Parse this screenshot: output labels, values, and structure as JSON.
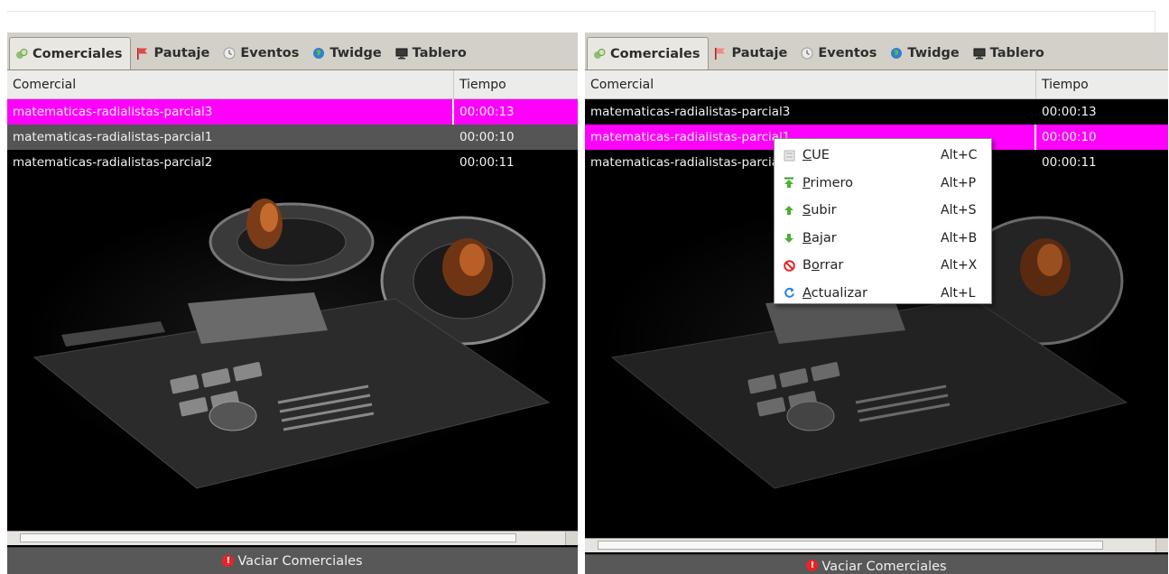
{
  "tabs": [
    {
      "label": "Comerciales",
      "icon": "commercials-icon"
    },
    {
      "label": "Pautaje",
      "icon": "flag-icon"
    },
    {
      "label": "Eventos",
      "icon": "clock-icon"
    },
    {
      "label": "Twidge",
      "icon": "globe-icon"
    },
    {
      "label": "Tablero",
      "icon": "monitor-icon"
    }
  ],
  "columns": {
    "commercial": "Comercial",
    "time": "Tiempo"
  },
  "left_panel": {
    "rows": [
      {
        "name": "matematicas-radialistas-parcial3",
        "time": "00:00:13"
      },
      {
        "name": "matematicas-radialistas-parcial1",
        "time": "00:00:10"
      },
      {
        "name": "matematicas-radialistas-parcial2",
        "time": "00:00:11"
      }
    ],
    "footer_button": "Vaciar Comerciales"
  },
  "right_panel": {
    "rows": [
      {
        "name": "matematicas-radialistas-parcial3",
        "time": "00:00:13"
      },
      {
        "name": "matematicas-radialistas-parcial1",
        "time": "00:00:10"
      },
      {
        "name": "matematicas-radialistas-parcial2",
        "time": "00:00:11"
      }
    ],
    "footer_button": "Vaciar Comerciales"
  },
  "context_menu": [
    {
      "label": "CUE",
      "mnemonic": "C",
      "shortcut": "Alt+C",
      "icon": "cue-icon"
    },
    {
      "label": "Primero",
      "mnemonic": "P",
      "shortcut": "Alt+P",
      "icon": "arrow-top-icon"
    },
    {
      "label": "Subir",
      "mnemonic": "S",
      "shortcut": "Alt+S",
      "icon": "arrow-up-icon"
    },
    {
      "label": "Bajar",
      "mnemonic": "B",
      "shortcut": "Alt+B",
      "icon": "arrow-down-icon"
    },
    {
      "label": "Borrar",
      "mnemonic": "o",
      "shortcut": "Alt+X",
      "icon": "delete-icon"
    },
    {
      "label": "Actualizar",
      "mnemonic": "A",
      "shortcut": "Alt+L",
      "icon": "refresh-icon"
    }
  ],
  "colors": {
    "selection": "#ff00ff",
    "alt_row": "#555555",
    "background": "#000000"
  }
}
